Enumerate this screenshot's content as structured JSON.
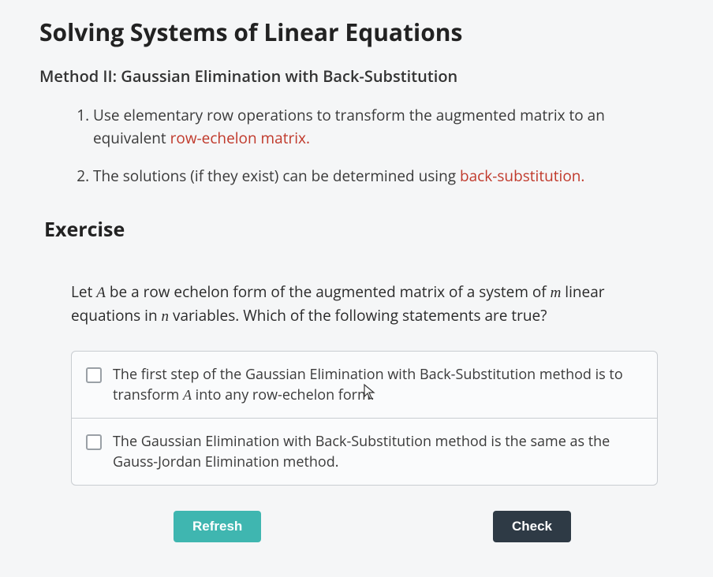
{
  "title": "Solving Systems of Linear Equations",
  "subtitle": "Method II: Gaussian Elimination with Back-Substitution",
  "method": {
    "item1_a": "Use elementary row operations to transform the augmented matrix to an equivalent ",
    "item1_b": "row-echelon matrix.",
    "item2_a": "The solutions (if they exist) can be determined using ",
    "item2_b": "back-substitution."
  },
  "exercise": {
    "heading": "Exercise",
    "question_a": "Let ",
    "question_var1": "A",
    "question_b": " be a row echelon form of the augmented matrix of a system of ",
    "question_var2": "m",
    "question_c": " linear equations in ",
    "question_var3": "n",
    "question_d": " variables. Which of the following statements are true?",
    "options": [
      {
        "text_a": "The first step of the Gaussian Elimination with Back-Substitution method is to transform ",
        "text_var": "A",
        "text_b": " into any row-echelon form."
      },
      {
        "text_a": "The Gaussian Elimination with Back-Substitution method is the same as the Gauss-Jordan Elimination method.",
        "text_var": "",
        "text_b": ""
      }
    ]
  },
  "buttons": {
    "refresh": "Refresh",
    "check": "Check"
  }
}
